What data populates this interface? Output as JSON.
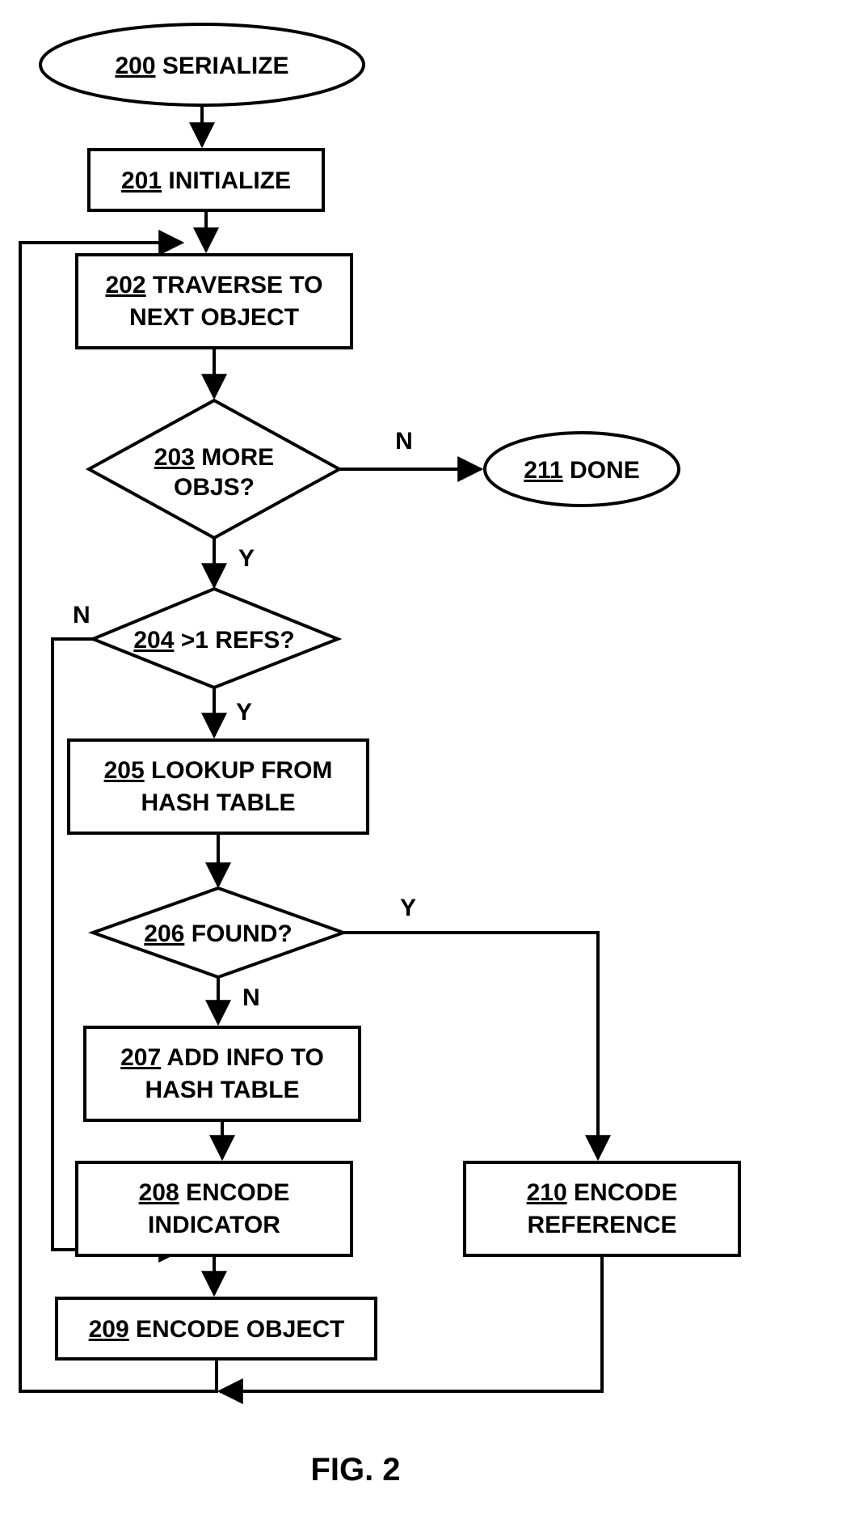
{
  "chart_data": {
    "type": "flowchart",
    "title": "FIG. 2",
    "nodes": [
      {
        "id": "200",
        "kind": "terminator",
        "num": "200",
        "label": "SERIALIZE"
      },
      {
        "id": "201",
        "kind": "process",
        "num": "201",
        "label": "INITIALIZE"
      },
      {
        "id": "202",
        "kind": "process",
        "num": "202",
        "label": "TRAVERSE TO NEXT OBJECT"
      },
      {
        "id": "203",
        "kind": "decision",
        "num": "203",
        "label": "MORE OBJS?"
      },
      {
        "id": "204",
        "kind": "decision",
        "num": "204",
        "label": ">1 REFS?"
      },
      {
        "id": "205",
        "kind": "process",
        "num": "205",
        "label": "LOOKUP FROM HASH TABLE"
      },
      {
        "id": "206",
        "kind": "decision",
        "num": "206",
        "label": "FOUND?"
      },
      {
        "id": "207",
        "kind": "process",
        "num": "207",
        "label": "ADD INFO TO HASH TABLE"
      },
      {
        "id": "208",
        "kind": "process",
        "num": "208",
        "label": "ENCODE INDICATOR"
      },
      {
        "id": "209",
        "kind": "process",
        "num": "209",
        "label": "ENCODE OBJECT"
      },
      {
        "id": "210",
        "kind": "process",
        "num": "210",
        "label": "ENCODE REFERENCE"
      },
      {
        "id": "211",
        "kind": "terminator",
        "num": "211",
        "label": "DONE"
      }
    ],
    "edges": [
      {
        "from": "200",
        "to": "201",
        "label": ""
      },
      {
        "from": "201",
        "to": "202",
        "label": ""
      },
      {
        "from": "202",
        "to": "203",
        "label": ""
      },
      {
        "from": "203",
        "to": "211",
        "label": "N"
      },
      {
        "from": "203",
        "to": "204",
        "label": "Y"
      },
      {
        "from": "204",
        "to": "209",
        "label": "N"
      },
      {
        "from": "204",
        "to": "205",
        "label": "Y"
      },
      {
        "from": "205",
        "to": "206",
        "label": ""
      },
      {
        "from": "206",
        "to": "210",
        "label": "Y"
      },
      {
        "from": "206",
        "to": "207",
        "label": "N"
      },
      {
        "from": "207",
        "to": "208",
        "label": ""
      },
      {
        "from": "208",
        "to": "209",
        "label": ""
      },
      {
        "from": "209",
        "to": "202",
        "label": ""
      },
      {
        "from": "210",
        "to": "202",
        "label": ""
      }
    ],
    "edge_labels": {
      "yes": "Y",
      "no": "N"
    }
  },
  "caption": "FIG. 2"
}
